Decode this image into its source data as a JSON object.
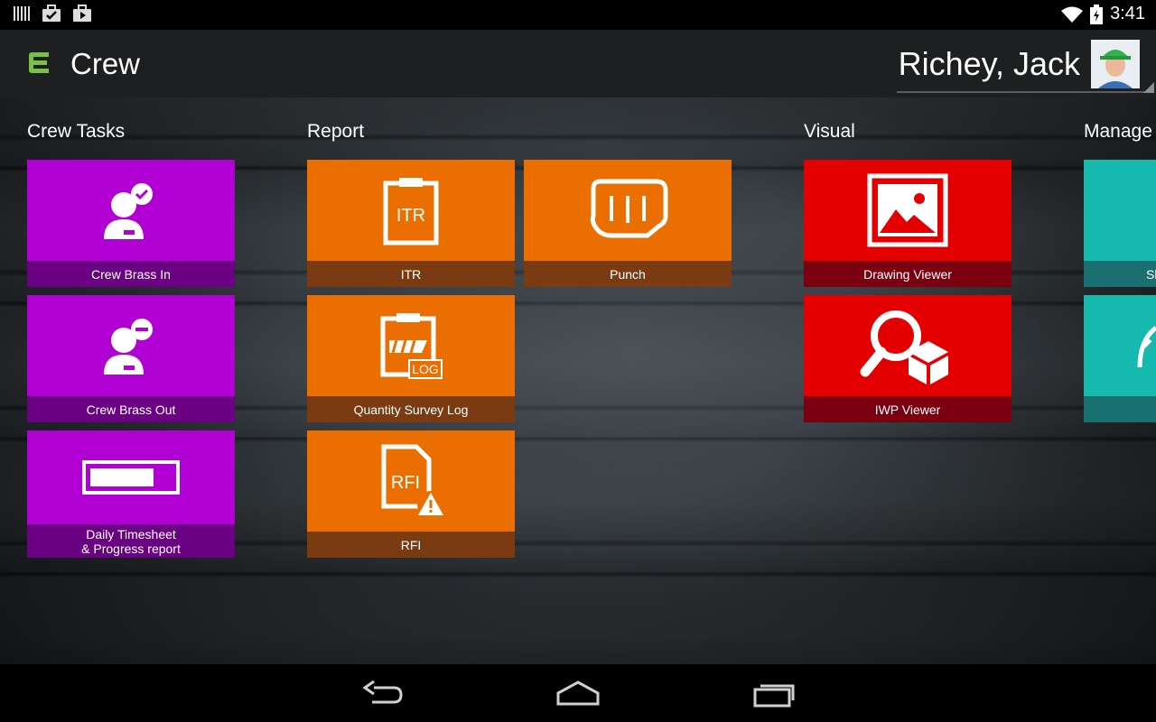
{
  "status_bar": {
    "time": "3:41",
    "icons": [
      "barcode-icon",
      "briefcase-check-icon",
      "play-store-icon",
      "wifi-icon",
      "battery-charging-icon"
    ]
  },
  "action_bar": {
    "app_title": "Crew",
    "user_name": "Richey, Jack"
  },
  "groups": {
    "crew_tasks": {
      "title": "Crew Tasks",
      "tiles": {
        "brass_in": "Crew Brass In",
        "brass_out": "Crew Brass Out",
        "timesheet_line1": "Daily Timesheet",
        "timesheet_line2": "& Progress report"
      }
    },
    "report": {
      "title": "Report",
      "tiles": {
        "itr": "ITR",
        "itr_icon_text": "ITR",
        "punch": "Punch",
        "qsl": "Quantity Survey Log",
        "qsl_icon_text": "LOG",
        "rfi": "RFI",
        "rfi_icon_text": "RFI"
      }
    },
    "visual": {
      "title": "Visual",
      "tiles": {
        "drawing_viewer": "Drawing Viewer",
        "iwp_viewer": "IWP Viewer"
      }
    },
    "manage": {
      "title": "Manage",
      "tiles": {
        "tile1_partial": "Sh"
      }
    }
  },
  "colors": {
    "crew_tasks": "#b000d4",
    "report": "#ea6f00",
    "visual": "#e40000",
    "manage": "#16b9ad",
    "logo": "#7ac143"
  }
}
